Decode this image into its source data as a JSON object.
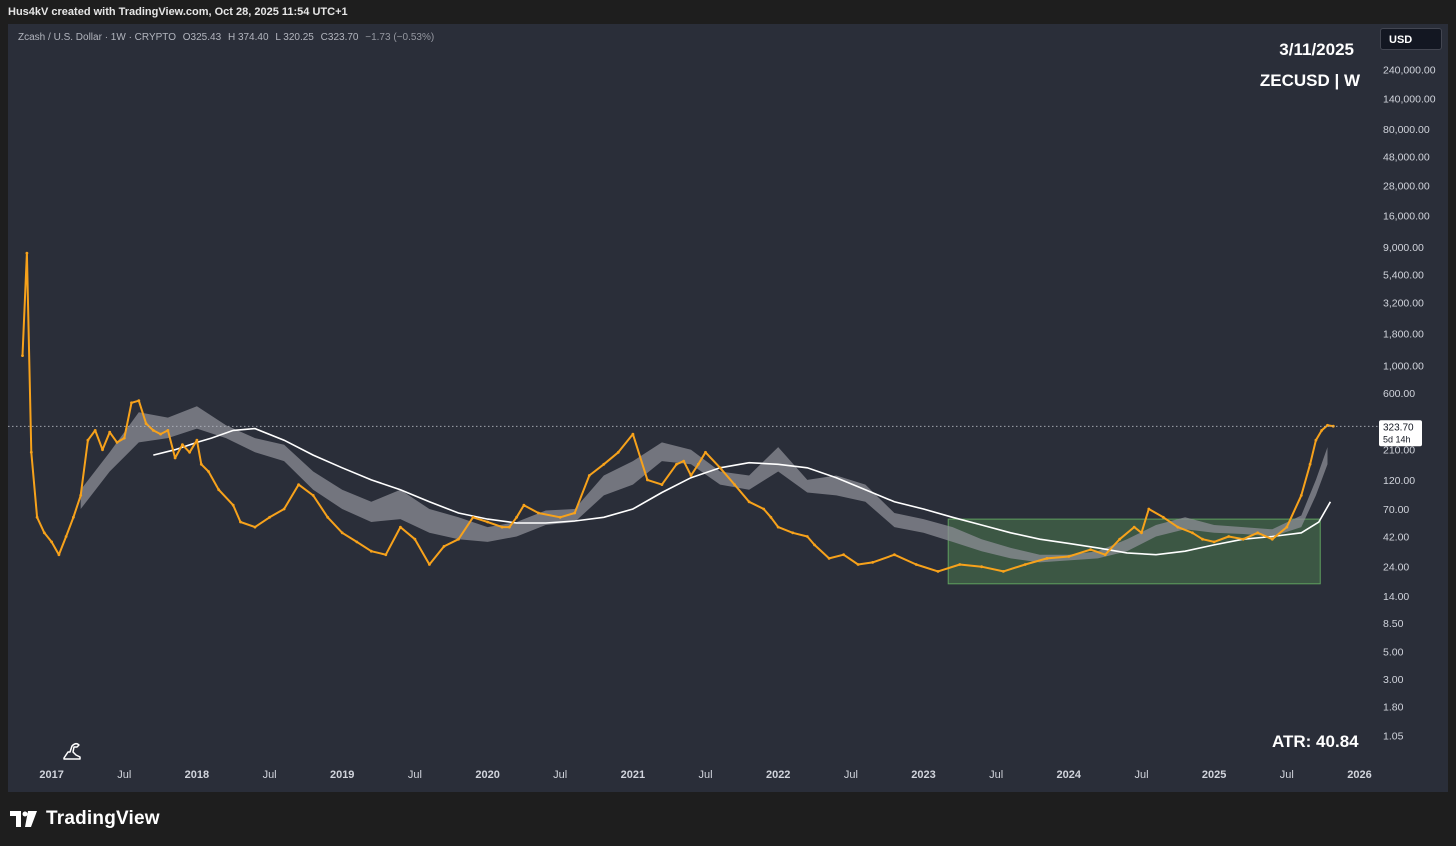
{
  "header": {
    "credit": "Hus4kV created with TradingView.com, Oct 28, 2025 11:54 UTC+1"
  },
  "legend": {
    "symbol_name": "Zcash / U.S. Dollar · 1W · CRYPTO",
    "open": "O325.43",
    "high": "H 374.40",
    "low": "L 320.25",
    "close": "C323.70",
    "change": "−1.73 (−0.53%)"
  },
  "currency_button": "USD",
  "overlay": {
    "date": "3/11/2025",
    "symbol": "ZECUSD | W",
    "atr": "ATR: 40.84"
  },
  "footer": {
    "brand": "TradingView"
  },
  "colors": {
    "background": "#2a2e39",
    "candle": "#f7a21b",
    "ma_fast_band": "#8c8e96",
    "ma_slow": "#ffffff",
    "box_fill": "#4a7a4e",
    "box_stroke": "#5fa05f"
  },
  "chart_data": {
    "type": "line",
    "scale": "log",
    "title": "",
    "xlabel": "",
    "ylabel": "",
    "x_ticks": [
      "2017",
      "Jul",
      "2018",
      "Jul",
      "2019",
      "Jul",
      "2020",
      "Jul",
      "2021",
      "Jul",
      "2022",
      "Jul",
      "2023",
      "Jul",
      "2024",
      "Jul",
      "2025",
      "Jul",
      "2026"
    ],
    "x_tick_years": [
      2017.0,
      2017.5,
      2018.0,
      2018.5,
      2019.0,
      2019.5,
      2020.0,
      2020.5,
      2021.0,
      2021.5,
      2022.0,
      2022.5,
      2023.0,
      2023.5,
      2024.0,
      2024.5,
      2025.0,
      2025.5,
      2026.0
    ],
    "y_ticks": [
      "240,000.00",
      "140,000.00",
      "80,000.00",
      "48,000.00",
      "28,000.00",
      "16,000.00",
      "9,000.00",
      "5,400.00",
      "3,200.00",
      "1,800.00",
      "1,000.00",
      "600.00",
      "210.00",
      "120.00",
      "70.00",
      "42.00",
      "24.00",
      "14.00",
      "8.50",
      "5.00",
      "3.00",
      "1.80",
      "1.05"
    ],
    "y_tick_values": [
      240000,
      140000,
      80000,
      48000,
      28000,
      16000,
      9000,
      5400,
      3200,
      1800,
      1000,
      600,
      210,
      120,
      70,
      42,
      24,
      14,
      8.5,
      5,
      3,
      1.8,
      1.05
    ],
    "last_price": "323.70",
    "countdown": "5d 14h",
    "price_series": {
      "name": "",
      "x": [
        2016.8,
        2016.83,
        2016.86,
        2016.9,
        2016.95,
        2017.0,
        2017.05,
        2017.1,
        2017.15,
        2017.2,
        2017.25,
        2017.3,
        2017.35,
        2017.4,
        2017.45,
        2017.5,
        2017.55,
        2017.6,
        2017.65,
        2017.7,
        2017.75,
        2017.8,
        2017.85,
        2017.9,
        2017.95,
        2018.0,
        2018.03,
        2018.08,
        2018.15,
        2018.25,
        2018.3,
        2018.4,
        2018.5,
        2018.6,
        2018.7,
        2018.8,
        2018.9,
        2019.0,
        2019.1,
        2019.2,
        2019.3,
        2019.4,
        2019.5,
        2019.6,
        2019.7,
        2019.8,
        2019.9,
        2020.0,
        2020.1,
        2020.15,
        2020.2,
        2020.25,
        2020.35,
        2020.5,
        2020.6,
        2020.7,
        2020.8,
        2020.9,
        2021.0,
        2021.1,
        2021.2,
        2021.3,
        2021.35,
        2021.4,
        2021.45,
        2021.5,
        2021.6,
        2021.7,
        2021.8,
        2021.9,
        2021.95,
        2022.0,
        2022.1,
        2022.2,
        2022.25,
        2022.35,
        2022.45,
        2022.55,
        2022.65,
        2022.8,
        2022.95,
        2023.1,
        2023.25,
        2023.4,
        2023.55,
        2023.7,
        2023.85,
        2024.0,
        2024.15,
        2024.25,
        2024.35,
        2024.45,
        2024.5,
        2024.55,
        2024.65,
        2024.75,
        2024.85,
        2024.92,
        2025.0,
        2025.1,
        2025.2,
        2025.3,
        2025.4,
        2025.5,
        2025.6,
        2025.66,
        2025.7,
        2025.74,
        2025.78,
        2025.82
      ],
      "values": [
        1200,
        8000,
        200,
        60,
        45,
        38,
        30,
        42,
        60,
        90,
        250,
        300,
        210,
        290,
        240,
        260,
        500,
        520,
        340,
        300,
        280,
        300,
        180,
        230,
        200,
        250,
        160,
        140,
        100,
        75,
        55,
        50,
        60,
        70,
        110,
        90,
        60,
        45,
        38,
        32,
        30,
        50,
        40,
        25,
        35,
        40,
        60,
        55,
        50,
        50,
        60,
        75,
        65,
        60,
        65,
        130,
        160,
        200,
        280,
        120,
        110,
        160,
        170,
        130,
        160,
        200,
        150,
        110,
        80,
        70,
        60,
        50,
        45,
        42,
        36,
        28,
        30,
        25,
        26,
        30,
        25,
        22,
        25,
        24,
        22,
        25,
        28,
        29,
        33,
        30,
        40,
        50,
        45,
        70,
        60,
        50,
        45,
        40,
        38,
        42,
        40,
        45,
        40,
        50,
        90,
        160,
        250,
        300,
        330,
        324
      ]
    },
    "ma_slow": {
      "name": "",
      "x": [
        2017.7,
        2017.85,
        2018.0,
        2018.1,
        2018.25,
        2018.4,
        2018.6,
        2018.8,
        2019.0,
        2019.2,
        2019.4,
        2019.6,
        2019.8,
        2020.0,
        2020.2,
        2020.4,
        2020.6,
        2020.8,
        2021.0,
        2021.2,
        2021.4,
        2021.6,
        2021.8,
        2022.0,
        2022.2,
        2022.4,
        2022.6,
        2022.8,
        2023.0,
        2023.2,
        2023.4,
        2023.6,
        2023.8,
        2024.0,
        2024.2,
        2024.4,
        2024.6,
        2024.8,
        2025.0,
        2025.2,
        2025.4,
        2025.6,
        2025.72,
        2025.8
      ],
      "values": [
        190,
        210,
        240,
        260,
        300,
        310,
        250,
        190,
        150,
        120,
        100,
        80,
        65,
        58,
        54,
        54,
        56,
        60,
        70,
        95,
        125,
        150,
        165,
        160,
        150,
        125,
        100,
        80,
        70,
        60,
        52,
        45,
        40,
        37,
        34,
        31,
        30,
        32,
        36,
        40,
        42,
        45,
        55,
        80
      ]
    },
    "ma_fast_band": {
      "name": "",
      "x": [
        2017.2,
        2017.4,
        2017.6,
        2017.8,
        2018.0,
        2018.2,
        2018.4,
        2018.6,
        2018.8,
        2019.0,
        2019.2,
        2019.4,
        2019.6,
        2019.8,
        2020.0,
        2020.2,
        2020.4,
        2020.6,
        2020.8,
        2021.0,
        2021.2,
        2021.4,
        2021.6,
        2021.8,
        2022.0,
        2022.2,
        2022.4,
        2022.6,
        2022.8,
        2023.0,
        2023.2,
        2023.4,
        2023.6,
        2023.8,
        2024.0,
        2024.2,
        2024.4,
        2024.6,
        2024.8,
        2025.0,
        2025.2,
        2025.4,
        2025.6,
        2025.7,
        2025.78
      ],
      "upper": [
        100,
        200,
        420,
        380,
        470,
        330,
        260,
        230,
        140,
        100,
        80,
        100,
        70,
        60,
        50,
        55,
        68,
        70,
        130,
        170,
        240,
        210,
        140,
        130,
        220,
        120,
        130,
        110,
        65,
        58,
        50,
        40,
        34,
        30,
        30,
        32,
        40,
        52,
        60,
        52,
        50,
        48,
        62,
        120,
        220
      ],
      "lower": [
        70,
        140,
        240,
        260,
        310,
        260,
        200,
        170,
        100,
        70,
        55,
        58,
        45,
        40,
        38,
        42,
        52,
        55,
        90,
        110,
        170,
        160,
        110,
        100,
        140,
        95,
        90,
        80,
        50,
        45,
        38,
        32,
        28,
        26,
        27,
        28,
        32,
        42,
        48,
        45,
        44,
        42,
        50,
        90,
        160
      ]
    },
    "range_box": {
      "x0": 2023.17,
      "x1": 2025.73,
      "y0": 17.5,
      "y1": 58
    },
    "ylim": [
      0.9,
      320000
    ],
    "xlim": [
      2016.7,
      2026.1
    ],
    "grid": false,
    "legend": "top-left"
  }
}
